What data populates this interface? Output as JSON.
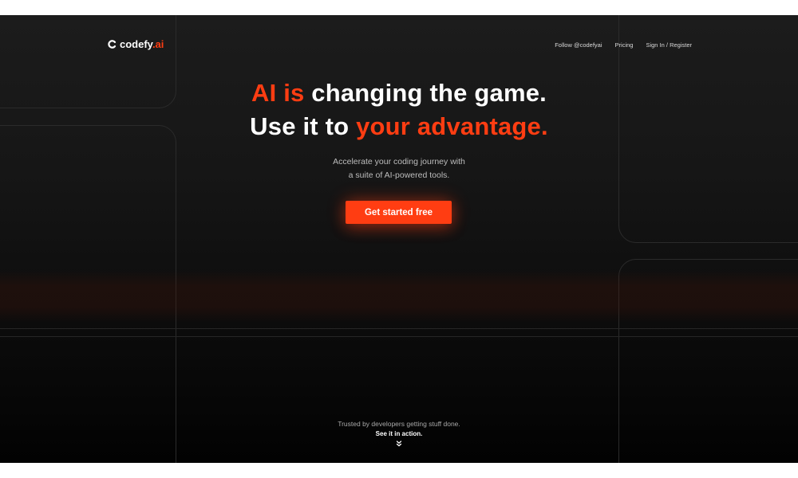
{
  "brand": {
    "name_main": "codefy",
    "name_accent": ".ai",
    "accent_color": "#ff3d12",
    "icon": "codefy-logo-icon"
  },
  "nav": {
    "follow": "Follow @codefyai",
    "pricing": "Pricing",
    "signin": "Sign In / Register"
  },
  "hero": {
    "line1_accent": "AI is",
    "line1_rest": " changing the game.",
    "line2_start": "Use it to ",
    "line2_accent": "your advantage.",
    "subtitle_line1": "Accelerate your coding journey with",
    "subtitle_line2": "a suite of AI-powered tools.",
    "cta_label": "Get started free"
  },
  "footer": {
    "trusted": "Trusted by developers getting stuff done.",
    "see_action": "See it in action.",
    "icon": "double-chevron-down-icon"
  }
}
